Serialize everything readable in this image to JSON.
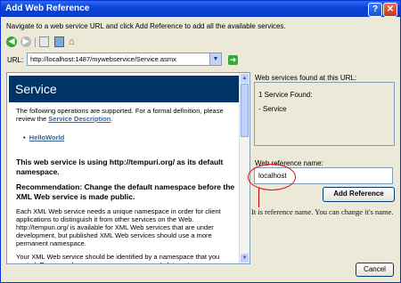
{
  "window": {
    "title": "Add Web Reference"
  },
  "instruction": "Navigate to a web service URL and click Add Reference to add all the available services.",
  "url": {
    "label": "URL:",
    "value": "http://localhost:1487/mywebservice/Service.asmx"
  },
  "browser": {
    "service_title": "Service",
    "intro": "The following operations are supported. For a formal definition, please review the",
    "service_description_link": "Service Description",
    "period": ".",
    "operation": "HelloWorld",
    "heading1": "This web service is using http://tempuri.org/ as its default namespace.",
    "heading2": "Recommendation: Change the default namespace before the XML Web service is made public.",
    "para1": "Each XML Web service needs a unique namespace in order for client applications to distinguish it from other services on the Web. http://tempuri.org/ is available for XML Web services that are under development, but published XML Web services should use a more permanent namespace.",
    "para2": "Your XML Web service should be identified by a namespace that you control. For example, you can use your company's Internet"
  },
  "found": {
    "label": "Web services found at this URL:",
    "count_text": "1 Service Found:",
    "service_item": "- Service"
  },
  "reference": {
    "label": "Web reference name:",
    "value": "localhost",
    "add_button": "Add Reference"
  },
  "annotation": "It is reference name. You can change it's name.",
  "cancel_button": "Cancel",
  "colors": {
    "title_bar": "#0a44d6",
    "service_banner": "#003366",
    "annotation": "#cc0000"
  }
}
